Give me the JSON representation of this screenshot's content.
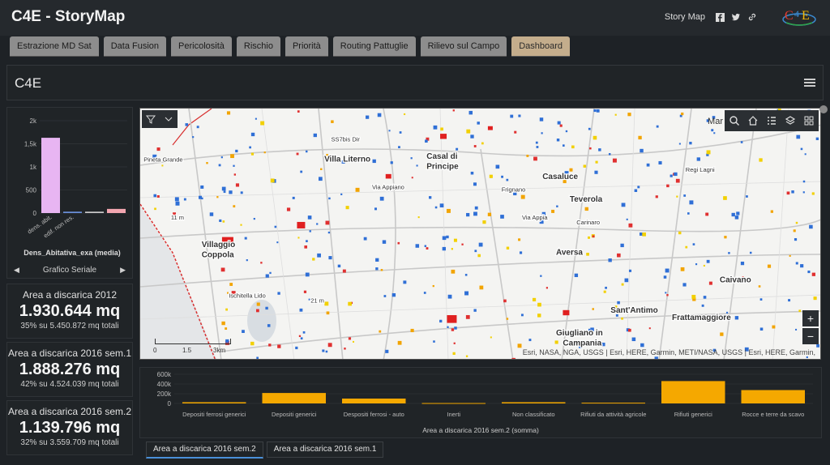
{
  "app": {
    "title": "C4E - StoryMap",
    "story_map_label": "Story Map"
  },
  "tabs": [
    {
      "label": "Estrazione MD Sat"
    },
    {
      "label": "Data Fusion"
    },
    {
      "label": "Pericolosità"
    },
    {
      "label": "Rischio"
    },
    {
      "label": "Priorità"
    },
    {
      "label": "Routing Pattuglie"
    },
    {
      "label": "Rilievo sul Campo"
    },
    {
      "label": "Dashboard",
      "active": true
    }
  ],
  "dashboard": {
    "title": "C4E"
  },
  "side_chart": {
    "nav_label": "Grafico Seriale",
    "chart_data": {
      "type": "bar",
      "title": "Dens_Abitativa_exa (media)",
      "categories": [
        "dens. abit.",
        "edif. non res.",
        "",
        ""
      ],
      "values": [
        1630,
        30,
        30,
        90
      ],
      "colors": [
        "#e8b5f2",
        "#6a8fd9",
        "#c9c9c9",
        "#f2a6b0"
      ],
      "yticks": [
        "0",
        "500",
        "1k",
        "1,5k",
        "2k"
      ],
      "ylim": [
        0,
        2000
      ]
    }
  },
  "stats": [
    {
      "label": "Area a discarica 2012",
      "value": "1.930.644 mq",
      "sub": "35% su 5.450.872 mq totali"
    },
    {
      "label": "Area a discarica 2016 sem.1",
      "value": "1.888.276 mq",
      "sub": "42% su 4.524.039 mq totali"
    },
    {
      "label": "Area a discarica 2016 sem.2",
      "value": "1.139.796 mq",
      "sub": "32% su 3.559.709 mq totali"
    }
  ],
  "map": {
    "mar_label": "Mar",
    "attribution": "Esri, NASA, NGA, USGS | Esri, HERE, Garmin, METI/NASA, USGS | Esri, HERE, Garmin,",
    "scale": [
      "0",
      "1.5",
      "3km"
    ],
    "zoom_in": "+",
    "zoom_out": "−",
    "places": [
      {
        "name": "Pineta Grande"
      },
      {
        "name": "Villa Literno"
      },
      {
        "name": "Casal di"
      },
      {
        "name": "Principe"
      },
      {
        "name": "Casaluce"
      },
      {
        "name": "Frignano"
      },
      {
        "name": "Teverola"
      },
      {
        "name": "Carinaro"
      },
      {
        "name": "Villaggio"
      },
      {
        "name": "Coppola"
      },
      {
        "name": "Aversa"
      },
      {
        "name": "Caivano"
      },
      {
        "name": "Ischitella Lido"
      },
      {
        "name": "Sant'Antimo"
      },
      {
        "name": "Frattamaggiore"
      },
      {
        "name": "Giugliano in"
      },
      {
        "name": "Campania"
      },
      {
        "name": "SS7bis Dir"
      },
      {
        "name": "Via Appiano"
      },
      {
        "name": "11 m"
      },
      {
        "name": "21 m"
      },
      {
        "name": "Regi Lagni"
      },
      {
        "name": "Via Appia"
      }
    ]
  },
  "bottom_chart": {
    "chart_data": {
      "type": "bar",
      "xlabel": "Area a discarica 2016 sem.2 (somma)",
      "categories": [
        "Depositi ferrosi generici",
        "Depositi generici",
        "Despositi ferrosi - auto",
        "Inerti",
        "Non classificato",
        "Rifiuti da attività agricole",
        "Rifiuti generici",
        "Rocce e terre da scavo"
      ],
      "values": [
        25000,
        215000,
        100000,
        8000,
        25000,
        15000,
        460000,
        275000
      ],
      "yticks": [
        "0",
        "200k",
        "400k",
        "600k"
      ],
      "ylim": [
        0,
        600000
      ],
      "color": "#f5a800"
    }
  },
  "bottom_tabs": [
    {
      "label": "Area a discarica 2016 sem.2",
      "active": true
    },
    {
      "label": "Area a discarica 2016 sem.1"
    }
  ]
}
